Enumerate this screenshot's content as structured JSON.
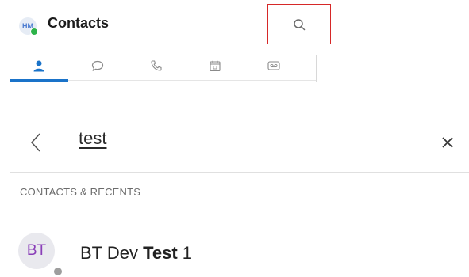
{
  "header": {
    "avatar_initials": "HM",
    "title": "Contacts",
    "search_icon": "search-icon"
  },
  "tabs": [
    {
      "icon": "person-icon",
      "active": true
    },
    {
      "icon": "chat-bubble-icon",
      "active": false
    },
    {
      "icon": "phone-icon",
      "active": false
    },
    {
      "icon": "calendar-icon",
      "active": false
    },
    {
      "icon": "voicemail-icon",
      "active": false
    }
  ],
  "search": {
    "query": "test"
  },
  "section": {
    "header": "CONTACTS & RECENTS"
  },
  "results": [
    {
      "initials": "BT",
      "name_prefix": "BT Dev ",
      "name_match": "Test",
      "name_suffix": " 1",
      "presence": "offline"
    }
  ],
  "colors": {
    "accent": "#1a73c9",
    "highlight_box": "#d62828",
    "presence_online": "#2db34a",
    "presence_offline": "#9e9e9e",
    "avatar_text": "#8a3fb8"
  }
}
